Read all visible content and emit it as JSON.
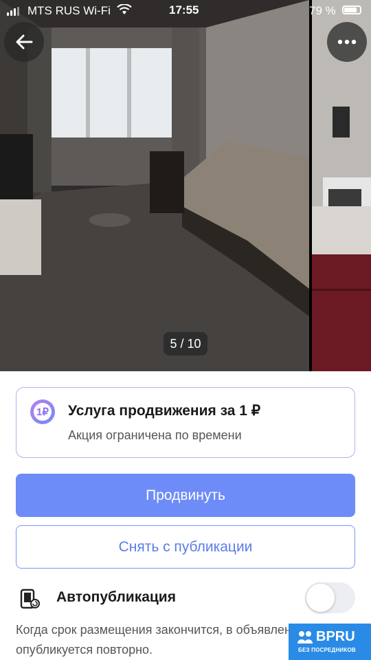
{
  "status_bar": {
    "carrier": "MTS RUS Wi-Fi",
    "time": "17:55",
    "battery": "79 %"
  },
  "gallery": {
    "counter": "5 / 10",
    "back_icon": "arrow-left-icon",
    "more_icon": "more-dots-icon"
  },
  "promo": {
    "icon_text": "1₽",
    "title": "Услуга продвижения за 1 ₽",
    "subtitle": "Акция ограничена по времени"
  },
  "actions": {
    "promote_label": "Продвинуть",
    "unpublish_label": "Снять с публикации"
  },
  "autopublish": {
    "label": "Автопубликация",
    "enabled": false,
    "description": "Когда срок размещения закончится, в объявление опубликуется повторно."
  },
  "badge": {
    "title": "BPRU",
    "subtitle": "БЕЗ ПОСРЕДНИКОВ"
  },
  "colors": {
    "primary": "#6e8cf7",
    "outline": "#7b95f2",
    "promo_border": "#b7aef0",
    "badge": "#2a8be6"
  }
}
